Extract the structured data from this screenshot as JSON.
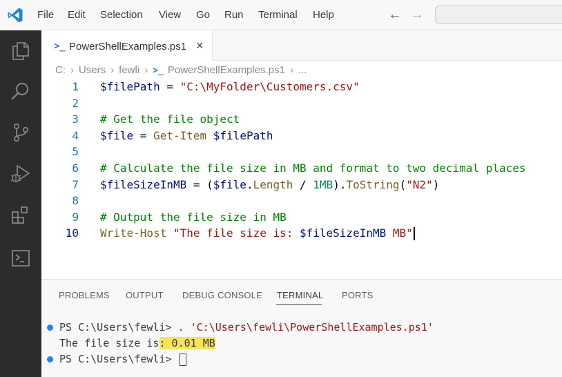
{
  "menu": {
    "items": [
      "File",
      "Edit",
      "Selection",
      "View",
      "Go",
      "Run",
      "Terminal",
      "Help"
    ]
  },
  "nav": {
    "back": "←",
    "forward": "→"
  },
  "tab": {
    "label": "PowerShellExamples.ps1",
    "close": "×",
    "icon": ">_"
  },
  "breadcrumb": {
    "parts": [
      "C:",
      "Users",
      "fewli",
      "PowerShellExamples.ps1",
      "..."
    ],
    "separator": "›"
  },
  "editor": {
    "lines": [
      {
        "num": "1",
        "segments": [
          {
            "t": "$filePath",
            "c": "var"
          },
          {
            "t": " = ",
            "c": "op"
          },
          {
            "t": "\"C:\\MyFolder\\Customers.csv\"",
            "c": "str"
          }
        ]
      },
      {
        "num": "2",
        "segments": []
      },
      {
        "num": "3",
        "segments": [
          {
            "t": "# Get the file object",
            "c": "cmt"
          }
        ]
      },
      {
        "num": "4",
        "segments": [
          {
            "t": "$file",
            "c": "var"
          },
          {
            "t": " = ",
            "c": "op"
          },
          {
            "t": "Get-Item",
            "c": "cmd"
          },
          {
            "t": " ",
            "c": "op"
          },
          {
            "t": "$filePath",
            "c": "var"
          }
        ]
      },
      {
        "num": "5",
        "segments": []
      },
      {
        "num": "6",
        "segments": [
          {
            "t": "# Calculate the file size in MB and format to two decimal places",
            "c": "cmt"
          }
        ]
      },
      {
        "num": "7",
        "segments": [
          {
            "t": "$fileSizeInMB",
            "c": "var"
          },
          {
            "t": " = (",
            "c": "op"
          },
          {
            "t": "$file",
            "c": "var"
          },
          {
            "t": ".",
            "c": "op"
          },
          {
            "t": "Length",
            "c": "cmd"
          },
          {
            "t": " / ",
            "c": "op"
          },
          {
            "t": "1MB",
            "c": "num"
          },
          {
            "t": ").",
            "c": "op"
          },
          {
            "t": "ToString",
            "c": "cmd"
          },
          {
            "t": "(",
            "c": "op"
          },
          {
            "t": "\"N2\"",
            "c": "str"
          },
          {
            "t": ")",
            "c": "op"
          }
        ]
      },
      {
        "num": "8",
        "segments": []
      },
      {
        "num": "9",
        "segments": [
          {
            "t": "# Output the file size in MB",
            "c": "cmt"
          }
        ]
      },
      {
        "num": "10",
        "segments": [
          {
            "t": "Write-Host",
            "c": "cmd"
          },
          {
            "t": " ",
            "c": "op"
          },
          {
            "t": "\"The file size is: ",
            "c": "str"
          },
          {
            "t": "$fileSizeInMB",
            "c": "var"
          },
          {
            "t": " MB\"",
            "c": "str"
          }
        ]
      }
    ],
    "active_line": "10"
  },
  "panel": {
    "tabs": [
      "PROBLEMS",
      "OUTPUT",
      "DEBUG CONSOLE",
      "TERMINAL",
      "PORTS"
    ],
    "active_tab": "TERMINAL"
  },
  "terminal": {
    "line1_prompt": "PS C:\\Users\\fewli> ",
    "line1_cmd": ". ",
    "line1_path": "'C:\\Users\\fewli\\PowerShellExamples.ps1'",
    "line2_prefix": "The file size is",
    "line2_highlight": ": 0.01 MB",
    "line3_prompt": "PS C:\\Users\\fewli> "
  },
  "colors": {
    "activity_bar": "#2c2c2c",
    "accent": "#1a85ff",
    "highlight": "#f7e35c"
  }
}
